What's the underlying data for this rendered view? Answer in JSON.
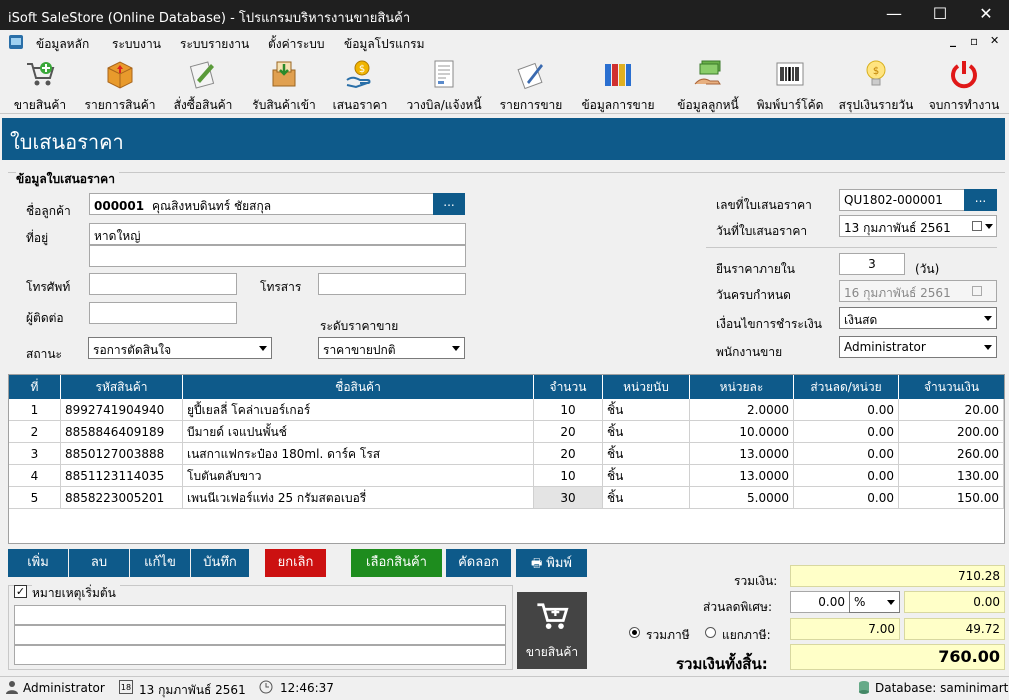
{
  "window": {
    "title": "iSoft SaleStore (Online Database) - โปรแกรมบริหารงานขายสินค้า",
    "minimize_glyph": "—",
    "maximize_glyph": "☐",
    "close_glyph": "✕"
  },
  "menu": {
    "items": [
      "ข้อมูลหลัก",
      "ระบบงาน",
      "ระบบรายงาน",
      "ตั้งค่าระบบ",
      "ข้อมูลโปรแกรม"
    ],
    "mdi_min": "_",
    "mdi_restore": "▫",
    "mdi_close": "✕"
  },
  "toolbar": {
    "items": [
      {
        "label": "ขายสินค้า",
        "icon": "cart-icon"
      },
      {
        "label": "รายการสินค้า",
        "icon": "box-icon"
      },
      {
        "label": "สั่งซื้อสินค้า",
        "icon": "order-icon"
      },
      {
        "label": "รับสินค้าเข้า",
        "icon": "receive-icon"
      },
      {
        "label": "เสนอราคา",
        "icon": "quote-icon"
      },
      {
        "label": "วางบิล/แจ้งหนี้",
        "icon": "invoice-icon"
      },
      {
        "label": "รายการขาย",
        "icon": "sales-list-icon"
      },
      {
        "label": "ข้อมูลการขาย",
        "icon": "binders-icon"
      },
      {
        "label": "ข้อมูลลูกหนี้",
        "icon": "debtor-icon"
      },
      {
        "label": "พิมพ์บาร์โค้ด",
        "icon": "barcode-icon"
      },
      {
        "label": "สรุปเงินรายวัน",
        "icon": "bulb-icon"
      },
      {
        "label": "จบการทำงาน",
        "icon": "power-icon"
      }
    ]
  },
  "header": {
    "title": "ใบเสนอราคา"
  },
  "form": {
    "section_title": "ข้อมูลใบเสนอราคา",
    "customer_label": "ชื่อลูกค้า",
    "customer_code": "000001",
    "customer_name": "คุณสิงหบดินทร์ ชัยสกุล",
    "dots": "...",
    "address_label": "ที่อยู่",
    "address_line1": "หาดใหญ่",
    "address_line2": "",
    "phone_label": "โทรศัพท์",
    "phone_value": "",
    "fax_label": "โทรสาร",
    "fax_value": "",
    "contact_label": "ผู้ติดต่อ",
    "contact_value": "",
    "status_label": "สถานะ",
    "status_value": "รอการตัดสินใจ",
    "price_level_label": "ระดับราคาขาย",
    "price_level_value": "ราคาขายปกติ",
    "quote_no_label": "เลขที่ใบเสนอราคา",
    "quote_no_value": "QU1802-000001",
    "quote_date_label": "วันที่ใบเสนอราคา",
    "quote_date_value": "13  กุมภาพันธ์   2561",
    "validity_label": "ยืนราคาภายใน",
    "validity_value": "3",
    "validity_unit": "(วัน)",
    "due_label": "วันครบกำหนด",
    "due_value": "16  กุมภาพันธ์   2561",
    "payment_label": "เงื่อนไขการชำระเงิน",
    "payment_value": "เงินสด",
    "salesperson_label": "พนักงานขาย",
    "salesperson_value": "Administrator"
  },
  "grid": {
    "headers": [
      "ที่",
      "รหัสสินค้า",
      "ชื่อสินค้า",
      "จำนวน",
      "หน่วยนับ",
      "หน่วยละ",
      "ส่วนลด/หน่วย",
      "จำนวนเงิน"
    ],
    "rows": [
      [
        "1",
        "8992741904940",
        "ยูปี้เยลลี่ โคล่าเบอร์เกอร์",
        "10",
        "ชิ้น",
        "2.0000",
        "0.00",
        "20.00"
      ],
      [
        "2",
        "8858846409189",
        "บีมายด์ เจแปนพั้นช์",
        "20",
        "ชิ้น",
        "10.0000",
        "0.00",
        "200.00"
      ],
      [
        "3",
        "8850127003888",
        "เนสกาแฟกระป๋อง 180ml. ดาร์ค โรส",
        "20",
        "ชิ้น",
        "13.0000",
        "0.00",
        "260.00"
      ],
      [
        "4",
        "8851123114035",
        "โบตันตลับขาว",
        "10",
        "ชิ้น",
        "13.0000",
        "0.00",
        "130.00"
      ],
      [
        "5",
        "8858223005201",
        "เพนนีเวเฟอร์แท่ง 25 กรัมสตอเบอรี่",
        "30",
        "ชิ้น",
        "5.0000",
        "0.00",
        "150.00"
      ]
    ]
  },
  "buttons": {
    "add": "เพิ่ม",
    "delete": "ลบ",
    "edit": "แก้ไข",
    "save": "บันทึก",
    "cancel": "ยกเลิก",
    "select_product": "เลือกสินค้า",
    "copy": "คัดลอก",
    "print": "พิมพ์",
    "sell": "ขายสินค้า"
  },
  "remarks": {
    "label": "หมายเหตุเริ่มต้น",
    "checked": true,
    "lines": [
      "",
      "",
      ""
    ]
  },
  "summary": {
    "total_label": "รวมเงิน:",
    "total_value": "710.28",
    "discount_label": "ส่วนลดพิเศษ:",
    "discount_input": "0.00",
    "discount_type": "%",
    "discount_value": "0.00",
    "vat_include_label": "รวมภาษี",
    "vat_exclude_label": "แยกภาษี:",
    "vat_rate": "7.00",
    "vat_value": "49.72",
    "grand_label": "รวมเงินทั้งสิ้น:",
    "grand_value": "760.00"
  },
  "status": {
    "user": "Administrator",
    "date": "13 กุมภาพันธ์ 2561",
    "time": "12:46:37",
    "database": "Database: saminimart",
    "calendar_day": "18"
  },
  "colors": {
    "accent_blue": "#0e5a8a",
    "cancel_red": "#cc1111",
    "select_green": "#1e8c1e",
    "sum_yellow": "#ffffc8"
  }
}
